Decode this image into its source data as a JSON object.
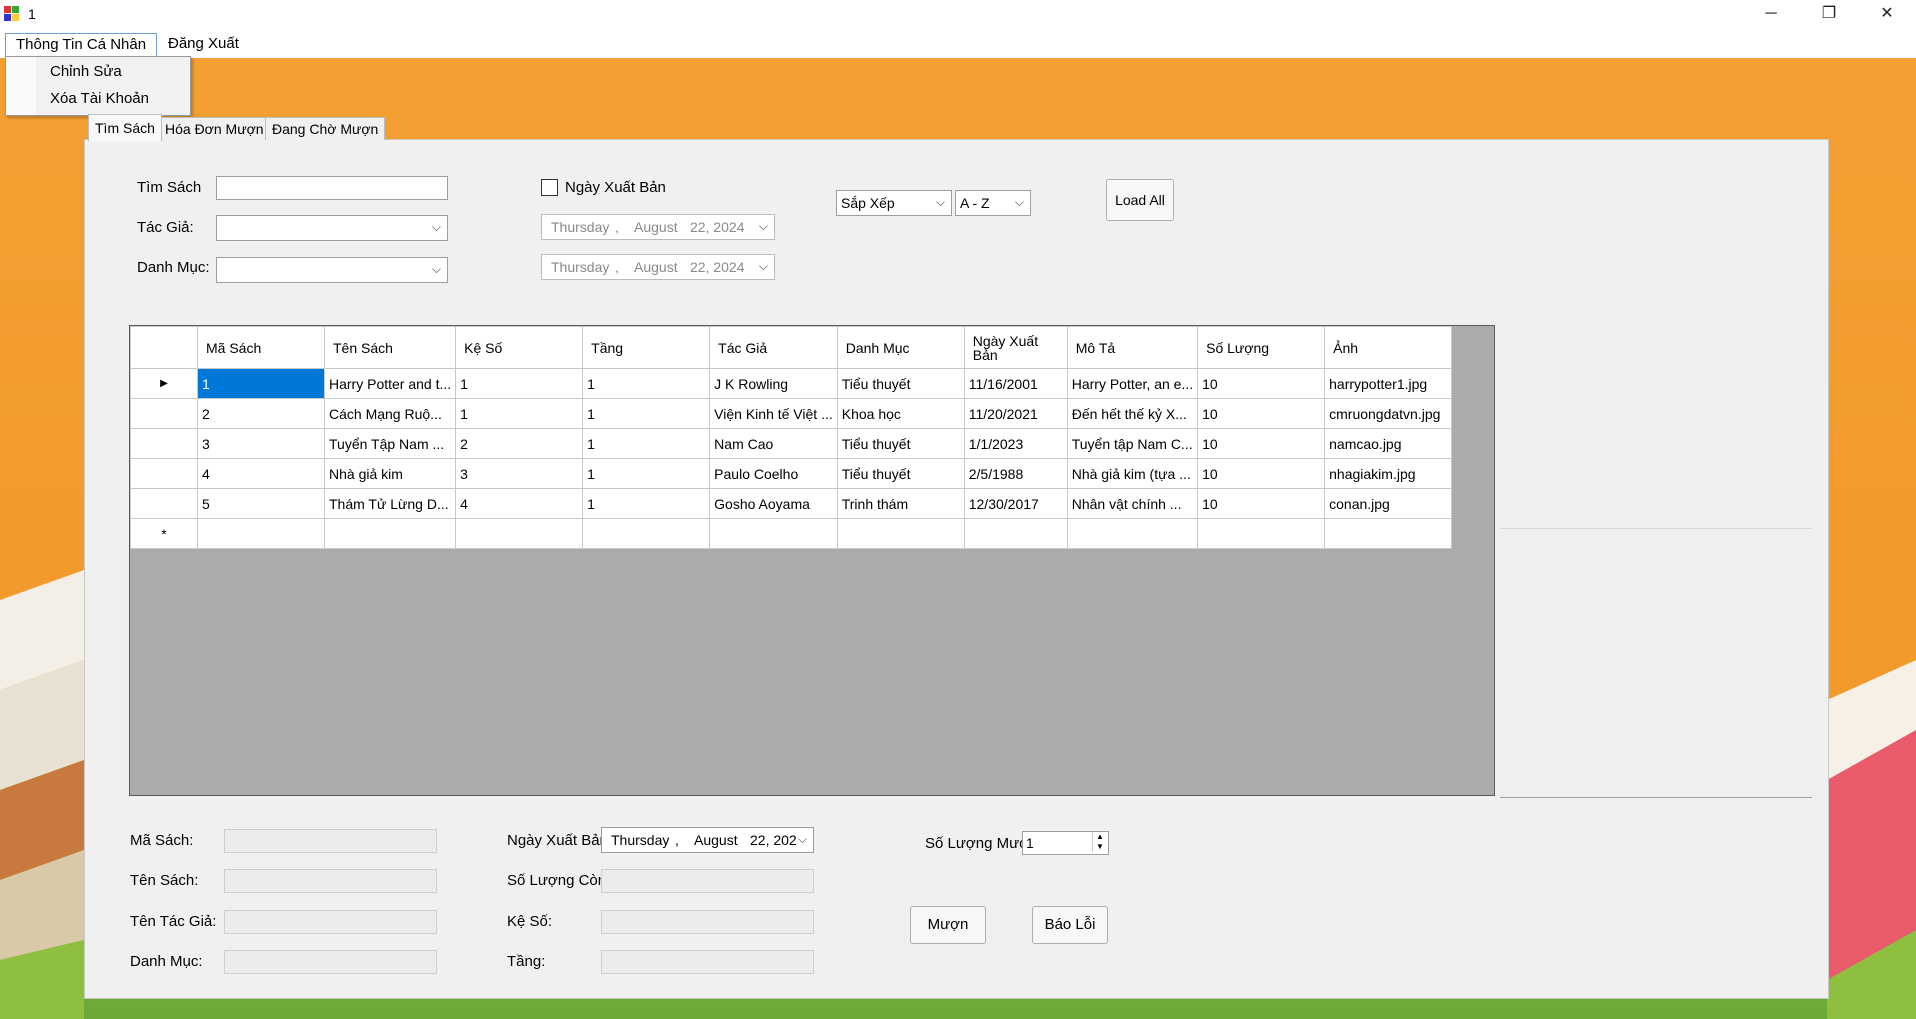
{
  "window": {
    "title": "1",
    "minimize": "─",
    "restore": "❐",
    "close": "✕"
  },
  "menu": {
    "profile": "Thông Tin Cá Nhân",
    "logout": "Đăng Xuất",
    "dropdown": [
      "Chỉnh Sửa",
      "Xóa Tài Khoản"
    ]
  },
  "tabs": [
    "Tìm Sách",
    "Hóa Đơn Mượn",
    "Đang Chờ Mượn"
  ],
  "search": {
    "book_label": "Tìm Sách",
    "book_value": "",
    "author_label": "Tác Giả:",
    "author_value": "",
    "category_label": "Danh Mục:",
    "category_value": "",
    "pubdate_checkbox": "Ngày Xuất Bản",
    "date_from": {
      "day": "Thursday",
      "sep": ",",
      "month": "August",
      "date": "22, 2024"
    },
    "date_to": {
      "day": "Thursday",
      "sep": ",",
      "month": "August",
      "date": "22, 2024"
    },
    "sort_value": "Sắp Xếp",
    "order_value": "A - Z",
    "load_all": "Load All"
  },
  "grid": {
    "columns": [
      "Mã Sách",
      "Tên Sách",
      "Kệ Số",
      "Tầng",
      "Tác Giả",
      "Danh Mục",
      "Ngày Xuất Bản",
      "Mô Tả",
      "Số Lượng",
      "Ảnh"
    ],
    "rows": [
      [
        "1",
        "Harry Potter and t...",
        "1",
        "1",
        "J K Rowling",
        "Tiểu thuyết",
        "11/16/2001",
        "Harry Potter, an e...",
        "10",
        "harrypotter1.jpg"
      ],
      [
        "2",
        "Cách Mạng Ruộ...",
        "1",
        "1",
        "Viện Kinh tế Việt ...",
        "Khoa học",
        "11/20/2021",
        "Đến hết thế kỷ X...",
        "10",
        "cmruongdatvn.jpg"
      ],
      [
        "3",
        "Tuyển Tập Nam ...",
        "2",
        "1",
        "Nam Cao",
        "Tiểu thuyết",
        "1/1/2023",
        "Tuyển tập Nam C...",
        "10",
        "namcao.jpg"
      ],
      [
        "4",
        "Nhà giả kim",
        "3",
        "1",
        "Paulo Coelho",
        "Tiểu thuyết",
        "2/5/1988",
        "Nhà giả kim (tựa ...",
        "10",
        "nhagiakim.jpg"
      ],
      [
        "5",
        "Thám Tử Lừng D...",
        "4",
        "1",
        "Gosho Aoyama",
        "Trinh thám",
        "12/30/2017",
        "Nhân vật chính ...",
        "10",
        "conan.jpg"
      ]
    ],
    "current_marker": "▶",
    "new_row_marker": "*"
  },
  "detail": {
    "code_label": "Mã Sách:",
    "name_label": "Tên Sách:",
    "author_label": "Tên Tác Giả:",
    "category_label": "Danh Mục:",
    "pubdate_label": "Ngày Xuất Bản:",
    "remaining_label": "Số Lượng Còn:",
    "shelf_label": "Kệ Số:",
    "floor_label": "Tầng:",
    "pubdate": {
      "day": "Thursday",
      "sep": ",",
      "month": "August",
      "date": "22, 202"
    },
    "qty_label": "Số Lượng Mượn:",
    "qty_value": "1",
    "borrow": "Mượn",
    "report": "Báo Lỗi"
  }
}
